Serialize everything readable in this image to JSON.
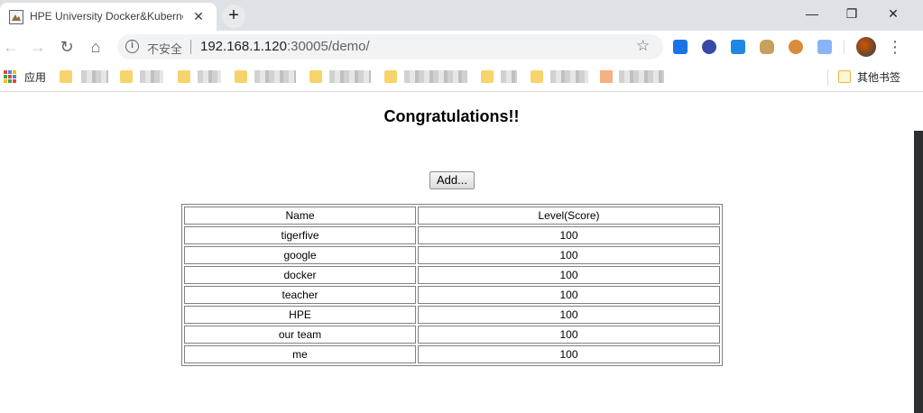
{
  "browser": {
    "tab_title": "HPE University Docker&Kubernetes",
    "tab_close_icon": "close-icon",
    "new_tab_icon": "plus-icon",
    "security_label": "不安全",
    "url_host": "192.168.1.120",
    "url_rest": ":30005/demo/",
    "window_controls": {
      "minimize": "—",
      "restore": "❐",
      "close": "✕"
    },
    "nav": {
      "back": "←",
      "forward": "→",
      "reload": "↻",
      "home": "⌂"
    },
    "star": "☆",
    "menu": "⋮",
    "info_glyph": "i"
  },
  "bookmarks": {
    "apps_label": "应用",
    "other_label": "其他书签"
  },
  "page": {
    "heading": "Congratulations!!",
    "add_button": "Add...",
    "table": {
      "headers": [
        "Name",
        "Level(Score)"
      ],
      "rows": [
        [
          "tigerfive",
          "100"
        ],
        [
          "google",
          "100"
        ],
        [
          "docker",
          "100"
        ],
        [
          "teacher",
          "100"
        ],
        [
          "HPE",
          "100"
        ],
        [
          "our team",
          "100"
        ],
        [
          "me",
          "100"
        ]
      ]
    }
  }
}
